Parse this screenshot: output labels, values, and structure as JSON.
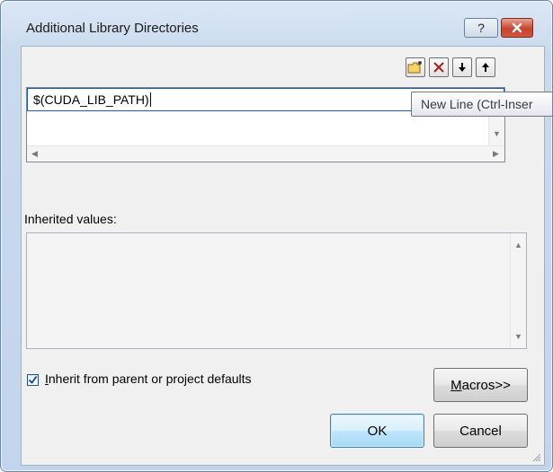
{
  "window": {
    "title": "Additional Library Directories",
    "help_icon": "?",
    "close_icon": "x"
  },
  "toolbar": {
    "new_line_icon": "new-folder",
    "delete_icon": "delete",
    "move_down_icon": "down-arrow",
    "move_up_icon": "up-arrow"
  },
  "edit_list": {
    "items": [
      "$(CUDA_LIB_PATH)"
    ]
  },
  "tooltip": "New Line (Ctrl-Inser",
  "inherited": {
    "label": "Inherited values:"
  },
  "inherit_checkbox": {
    "checked": true,
    "label_first": "I",
    "label_rest": "nherit from parent or project defaults"
  },
  "buttons": {
    "macros_first": "M",
    "macros_rest": "acros>>",
    "ok": "OK",
    "cancel": "Cancel"
  },
  "colors": {
    "titlebar": "#c9daee",
    "close": "#c7442e",
    "default_button": "#bee6fd"
  }
}
